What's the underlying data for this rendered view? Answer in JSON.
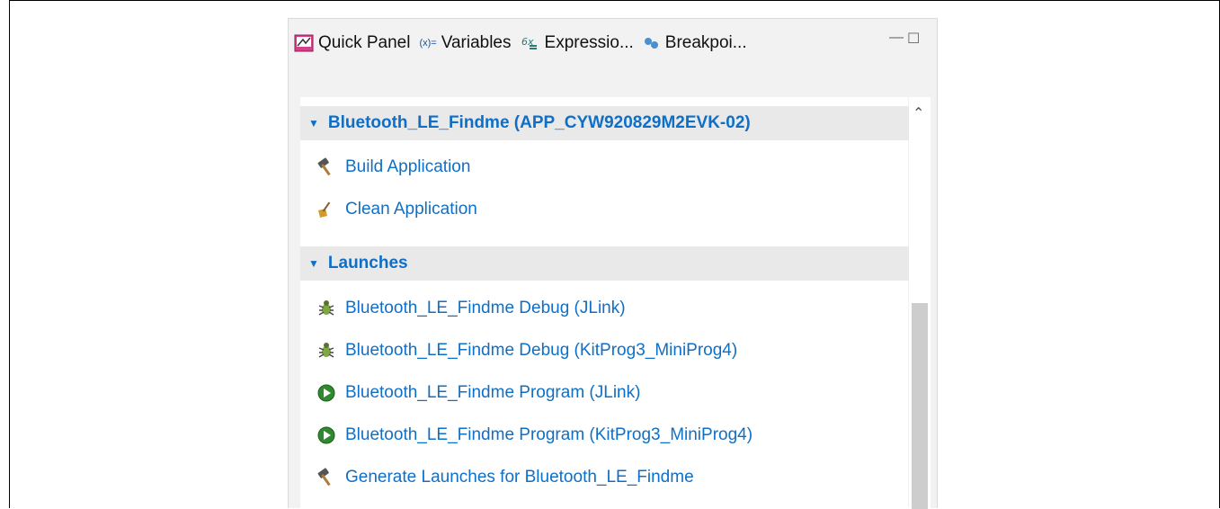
{
  "tabs": [
    {
      "label": "Quick Panel",
      "icon": "quick-panel-icon"
    },
    {
      "label": "Variables",
      "icon": "variables-icon",
      "icon_text": "(x)="
    },
    {
      "label": "Expressio...",
      "icon": "expressions-icon",
      "icon_text": "6x"
    },
    {
      "label": "Breakpoi...",
      "icon": "breakpoints-icon"
    }
  ],
  "window_controls": {
    "minimize": "—",
    "maximize": "☐"
  },
  "sections": [
    {
      "title": "Bluetooth_LE_Findme (APP_CYW920829M2EVK-02)",
      "items": [
        {
          "label": "Build Application",
          "icon": "hammer-icon"
        },
        {
          "label": "Clean Application",
          "icon": "broom-icon"
        }
      ]
    },
    {
      "title": "Launches",
      "items": [
        {
          "label": "Bluetooth_LE_Findme Debug (JLink)",
          "icon": "debug-bug-icon"
        },
        {
          "label": "Bluetooth_LE_Findme Debug (KitProg3_MiniProg4)",
          "icon": "debug-bug-icon"
        },
        {
          "label": "Bluetooth_LE_Findme Program (JLink)",
          "icon": "run-play-icon"
        },
        {
          "label": "Bluetooth_LE_Findme Program (KitProg3_MiniProg4)",
          "icon": "run-play-icon"
        },
        {
          "label": "Generate Launches for Bluetooth_LE_Findme",
          "icon": "hammer-icon"
        }
      ]
    }
  ],
  "colors": {
    "link": "#0f6fc6",
    "header_bg": "#e9e9e9",
    "tabbar_bg": "#f2f2f2",
    "scroll_thumb": "#cdcdcd"
  }
}
